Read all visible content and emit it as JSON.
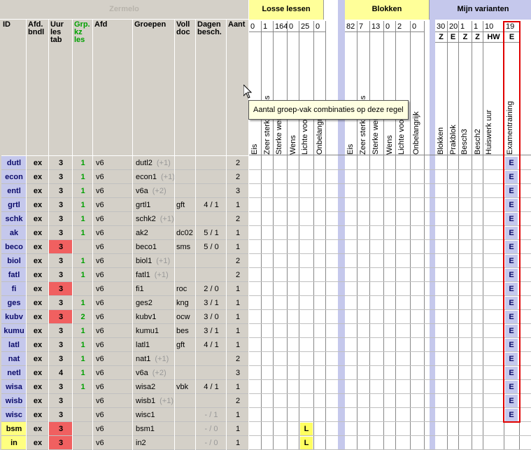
{
  "groups": {
    "zermelo": "Zermelo",
    "losse": "Losse lessen",
    "blokken": "Blokken",
    "mijn": "Mijn varianten"
  },
  "headers": {
    "id": "ID",
    "afd_bndl": "Afd. bndl",
    "uur_les_tab": "Uur les tab",
    "grp_kz_les": "Grp. kz les",
    "afd": "Afd",
    "groepen": "Groepen",
    "voll_doc": "Voll doc",
    "dagen_besch": "Dagen besch.",
    "aant": "Aant"
  },
  "losse_cols": [
    {
      "count": "0",
      "label": "Eis"
    },
    {
      "count": "1",
      "label": "Zeer sterke wens"
    },
    {
      "count": "164",
      "label": "Sterke wens"
    },
    {
      "count": "0",
      "label": "Wens"
    },
    {
      "count": "25",
      "label": "Lichte voorkeur"
    },
    {
      "count": "0",
      "label": "Onbelangrijk"
    }
  ],
  "blokken_cols": [
    {
      "count": "82",
      "label": "Eis"
    },
    {
      "count": "7",
      "label": "Zeer sterke wens"
    },
    {
      "count": "13",
      "label": "Sterke wens"
    },
    {
      "count": "0",
      "label": "Wens"
    },
    {
      "count": "2",
      "label": "Lichte voorkeur"
    },
    {
      "count": "0",
      "label": "Onbelangrijk"
    }
  ],
  "mijn_cols": [
    {
      "count": "30",
      "code": "Z",
      "label": "Blokken"
    },
    {
      "count": "20",
      "code": "E",
      "label": "Prakblok"
    },
    {
      "count": "1",
      "code": "Z",
      "label": "Besch3"
    },
    {
      "count": "1",
      "code": "Z",
      "label": "Besch2"
    },
    {
      "count": "10",
      "code": "HW",
      "label": "Huiswerk uur"
    },
    {
      "count": "19",
      "code": "E",
      "label": "Examentraining"
    }
  ],
  "tooltip": "Aantal groep-vak combinaties op deze regel",
  "rows": [
    {
      "id": "dutl",
      "afd_bndl": "ex",
      "uur": "3",
      "uur_red": false,
      "grp": "1",
      "afd": "v6",
      "groep": "dutl2",
      "plus": "(+1)",
      "voll": "",
      "dagen": "",
      "aant": "2",
      "losse_l": "",
      "mijn_e": "E"
    },
    {
      "id": "econ",
      "afd_bndl": "ex",
      "uur": "3",
      "uur_red": false,
      "grp": "1",
      "afd": "v6",
      "groep": "econ1",
      "plus": "(+1)",
      "voll": "",
      "dagen": "",
      "aant": "2",
      "losse_l": "",
      "mijn_e": "E"
    },
    {
      "id": "entl",
      "afd_bndl": "ex",
      "uur": "3",
      "uur_red": false,
      "grp": "1",
      "afd": "v6",
      "groep": "v6a",
      "plus": "(+2)",
      "voll": "",
      "dagen": "",
      "aant": "3",
      "losse_l": "",
      "mijn_e": "E"
    },
    {
      "id": "grtl",
      "afd_bndl": "ex",
      "uur": "3",
      "uur_red": false,
      "grp": "1",
      "afd": "v6",
      "groep": "grtl1",
      "plus": "",
      "voll": "gft",
      "dagen": "4 / 1",
      "aant": "1",
      "losse_l": "",
      "mijn_e": "E"
    },
    {
      "id": "schk",
      "afd_bndl": "ex",
      "uur": "3",
      "uur_red": false,
      "grp": "1",
      "afd": "v6",
      "groep": "schk2",
      "plus": "(+1)",
      "voll": "",
      "dagen": "",
      "aant": "2",
      "losse_l": "",
      "mijn_e": "E"
    },
    {
      "id": "ak",
      "afd_bndl": "ex",
      "uur": "3",
      "uur_red": false,
      "grp": "1",
      "afd": "v6",
      "groep": "ak2",
      "plus": "",
      "voll": "dc02",
      "dagen": "5 / 1",
      "aant": "1",
      "losse_l": "",
      "mijn_e": "E"
    },
    {
      "id": "beco",
      "afd_bndl": "ex",
      "uur": "3",
      "uur_red": true,
      "grp": "",
      "afd": "v6",
      "groep": "beco1",
      "plus": "",
      "voll": "sms",
      "dagen": "5 / 0",
      "aant": "1",
      "losse_l": "",
      "mijn_e": "E"
    },
    {
      "id": "biol",
      "afd_bndl": "ex",
      "uur": "3",
      "uur_red": false,
      "grp": "1",
      "afd": "v6",
      "groep": "biol1",
      "plus": "(+1)",
      "voll": "",
      "dagen": "",
      "aant": "2",
      "losse_l": "",
      "mijn_e": "E"
    },
    {
      "id": "fatl",
      "afd_bndl": "ex",
      "uur": "3",
      "uur_red": false,
      "grp": "1",
      "afd": "v6",
      "groep": "fatl1",
      "plus": "(+1)",
      "voll": "",
      "dagen": "",
      "aant": "2",
      "losse_l": "",
      "mijn_e": "E"
    },
    {
      "id": "fi",
      "afd_bndl": "ex",
      "uur": "3",
      "uur_red": true,
      "grp": "",
      "afd": "v6",
      "groep": "fi1",
      "plus": "",
      "voll": "roc",
      "dagen": "2 / 0",
      "aant": "1",
      "losse_l": "",
      "mijn_e": "E"
    },
    {
      "id": "ges",
      "afd_bndl": "ex",
      "uur": "3",
      "uur_red": false,
      "grp": "1",
      "afd": "v6",
      "groep": "ges2",
      "plus": "",
      "voll": "kng",
      "dagen": "3 / 1",
      "aant": "1",
      "losse_l": "",
      "mijn_e": "E"
    },
    {
      "id": "kubv",
      "afd_bndl": "ex",
      "uur": "3",
      "uur_red": true,
      "grp": "2",
      "afd": "v6",
      "groep": "kubv1",
      "plus": "",
      "voll": "ocw",
      "dagen": "3 / 0",
      "aant": "1",
      "losse_l": "",
      "mijn_e": "E"
    },
    {
      "id": "kumu",
      "afd_bndl": "ex",
      "uur": "3",
      "uur_red": false,
      "grp": "1",
      "afd": "v6",
      "groep": "kumu1",
      "plus": "",
      "voll": "bes",
      "dagen": "3 / 1",
      "aant": "1",
      "losse_l": "",
      "mijn_e": "E"
    },
    {
      "id": "latl",
      "afd_bndl": "ex",
      "uur": "3",
      "uur_red": false,
      "grp": "1",
      "afd": "v6",
      "groep": "latl1",
      "plus": "",
      "voll": "gft",
      "dagen": "4 / 1",
      "aant": "1",
      "losse_l": "",
      "mijn_e": "E"
    },
    {
      "id": "nat",
      "afd_bndl": "ex",
      "uur": "3",
      "uur_red": false,
      "grp": "1",
      "afd": "v6",
      "groep": "nat1",
      "plus": "(+1)",
      "voll": "",
      "dagen": "",
      "aant": "2",
      "losse_l": "",
      "mijn_e": "E"
    },
    {
      "id": "netl",
      "afd_bndl": "ex",
      "uur": "4",
      "uur_red": false,
      "grp": "1",
      "afd": "v6",
      "groep": "v6a",
      "plus": "(+2)",
      "voll": "",
      "dagen": "",
      "aant": "3",
      "losse_l": "",
      "mijn_e": "E"
    },
    {
      "id": "wisa",
      "afd_bndl": "ex",
      "uur": "3",
      "uur_red": false,
      "grp": "1",
      "afd": "v6",
      "groep": "wisa2",
      "plus": "",
      "voll": "vbk",
      "dagen": "4 / 1",
      "aant": "1",
      "losse_l": "",
      "mijn_e": "E"
    },
    {
      "id": "wisb",
      "afd_bndl": "ex",
      "uur": "3",
      "uur_red": false,
      "grp": "",
      "afd": "v6",
      "groep": "wisb1",
      "plus": "(+1)",
      "voll": "",
      "dagen": "",
      "aant": "2",
      "losse_l": "",
      "mijn_e": "E"
    },
    {
      "id": "wisc",
      "afd_bndl": "ex",
      "uur": "3",
      "uur_red": false,
      "grp": "",
      "afd": "v6",
      "groep": "wisc1",
      "plus": "",
      "voll": "",
      "dagen": "- / 1",
      "aant": "1",
      "losse_l": "",
      "mijn_e": "E"
    },
    {
      "id": "bsm",
      "afd_bndl": "ex",
      "uur": "3",
      "uur_red": true,
      "grp": "",
      "afd": "v6",
      "groep": "bsm1",
      "plus": "",
      "voll": "",
      "dagen": "- / 0",
      "aant": "1",
      "losse_l": "L",
      "mijn_e": ""
    },
    {
      "id": "in",
      "afd_bndl": "ex",
      "uur": "3",
      "uur_red": true,
      "grp": "",
      "afd": "v6",
      "groep": "in2",
      "plus": "",
      "voll": "",
      "dagen": "- / 0",
      "aant": "1",
      "losse_l": "L",
      "mijn_e": ""
    }
  ],
  "colors": {
    "header_grey": "#d4d0c8",
    "group_yellow": "#ffff99",
    "group_blue": "#c5c8ec",
    "id_blue": "#c5c8ec",
    "red_cell": "#f06060",
    "green_text": "#00a000",
    "highlight_border": "#e00000"
  }
}
